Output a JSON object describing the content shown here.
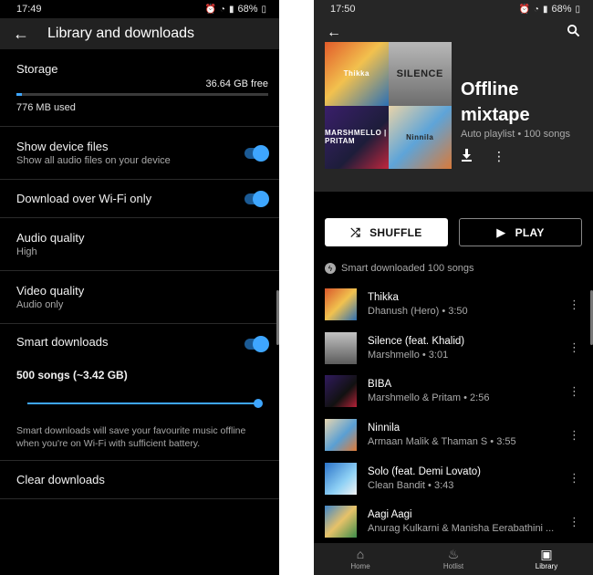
{
  "left": {
    "status": {
      "time": "17:49",
      "battery": "68%"
    },
    "appbar": {
      "back": "←",
      "title": "Library and downloads"
    },
    "storage": {
      "label": "Storage",
      "free": "36.64 GB free",
      "used": "776 MB used",
      "used_fraction": 0.02
    },
    "device_files": {
      "title": "Show device files",
      "subtitle": "Show all audio files on your device",
      "enabled": true
    },
    "wifi_only": {
      "title": "Download over Wi-Fi only",
      "enabled": true
    },
    "audio_quality": {
      "title": "Audio quality",
      "value": "High"
    },
    "video_quality": {
      "title": "Video quality",
      "value": "Audio only"
    },
    "smart_downloads": {
      "title": "Smart downloads",
      "enabled": true,
      "count_label": "500 songs (~3.42 GB)",
      "slider_fraction": 1.0,
      "description": "Smart downloads will save your favourite music offline when you're on Wi-Fi with sufficient battery."
    },
    "clear_downloads": {
      "title": "Clear downloads"
    }
  },
  "right": {
    "status": {
      "time": "17:50",
      "battery": "68%"
    },
    "appbar": {
      "back": "←",
      "search_icon": "search-icon"
    },
    "playlist": {
      "title": "Offline mixtape",
      "meta": "Auto playlist • 100 songs",
      "covers": [
        "Thikka",
        "SILENCE",
        "MARSHMELLO | PRITAM",
        "Ninnila"
      ]
    },
    "buttons": {
      "shuffle": "SHUFFLE",
      "play": "PLAY"
    },
    "smart_note": "Smart downloaded 100 songs",
    "songs": [
      {
        "title": "Thikka",
        "subtitle": "Dhanush (Hero) • 3:50"
      },
      {
        "title": "Silence (feat. Khalid)",
        "subtitle": "Marshmello • 3:01"
      },
      {
        "title": "BIBA",
        "subtitle": "Marshmello & Pritam • 2:56"
      },
      {
        "title": "Ninnila",
        "subtitle": "Armaan Malik & Thaman S • 3:55"
      },
      {
        "title": "Solo (feat. Demi Lovato)",
        "subtitle": "Clean Bandit • 3:43"
      },
      {
        "title": "Aagi Aagi",
        "subtitle": "Anurag Kulkarni & Manisha Eerabathini ..."
      }
    ],
    "nav": [
      {
        "label": "Home",
        "icon": "home-icon"
      },
      {
        "label": "Hotlist",
        "icon": "flame-icon"
      },
      {
        "label": "Library",
        "icon": "library-icon",
        "active": true
      }
    ]
  }
}
